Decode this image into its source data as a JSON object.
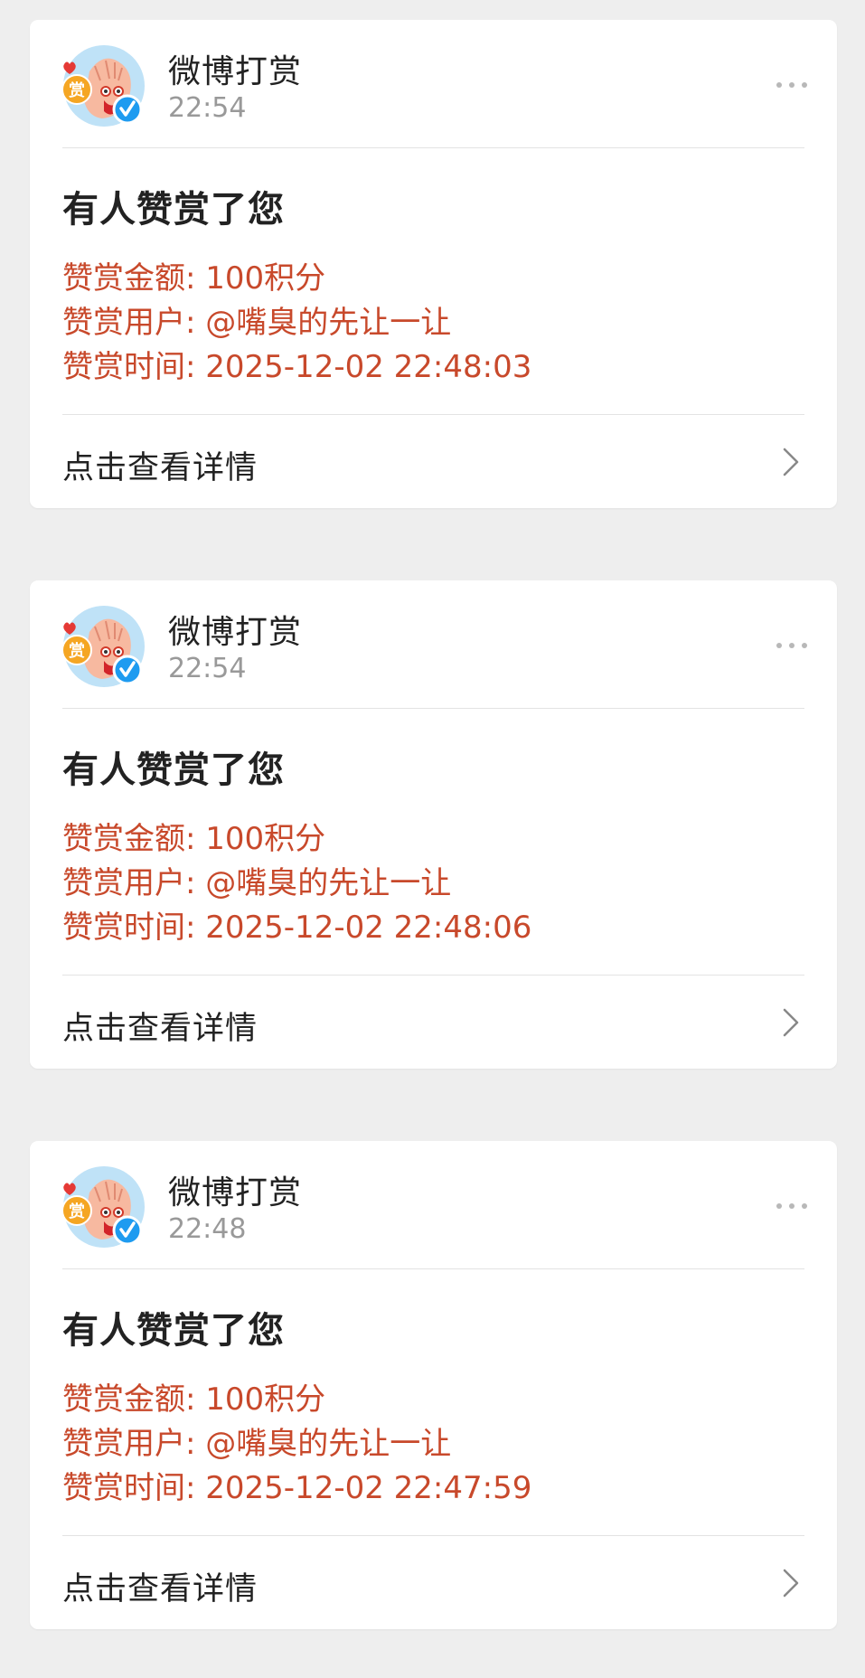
{
  "accent_color": "#c8492b",
  "verified_color": "#1e9bf0",
  "notifications": [
    {
      "sender": "微博打赏",
      "time": "22:54",
      "avatar_label": "赏",
      "title": "有人赞赏了您",
      "amount_line": "赞赏金额: 100积分",
      "user_line": "赞赏用户: @嘴臭的先让一让",
      "time_line": "赞赏时间: 2025-12-02 22:48:03",
      "footer": "点击查看详情"
    },
    {
      "sender": "微博打赏",
      "time": "22:54",
      "avatar_label": "赏",
      "title": "有人赞赏了您",
      "amount_line": "赞赏金额: 100积分",
      "user_line": "赞赏用户: @嘴臭的先让一让",
      "time_line": "赞赏时间: 2025-12-02 22:48:06",
      "footer": "点击查看详情"
    },
    {
      "sender": "微博打赏",
      "time": "22:48",
      "avatar_label": "赏",
      "title": "有人赞赏了您",
      "amount_line": "赞赏金额: 100积分",
      "user_line": "赞赏用户: @嘴臭的先让一让",
      "time_line": "赞赏时间: 2025-12-02 22:47:59",
      "footer": "点击查看详情"
    }
  ]
}
